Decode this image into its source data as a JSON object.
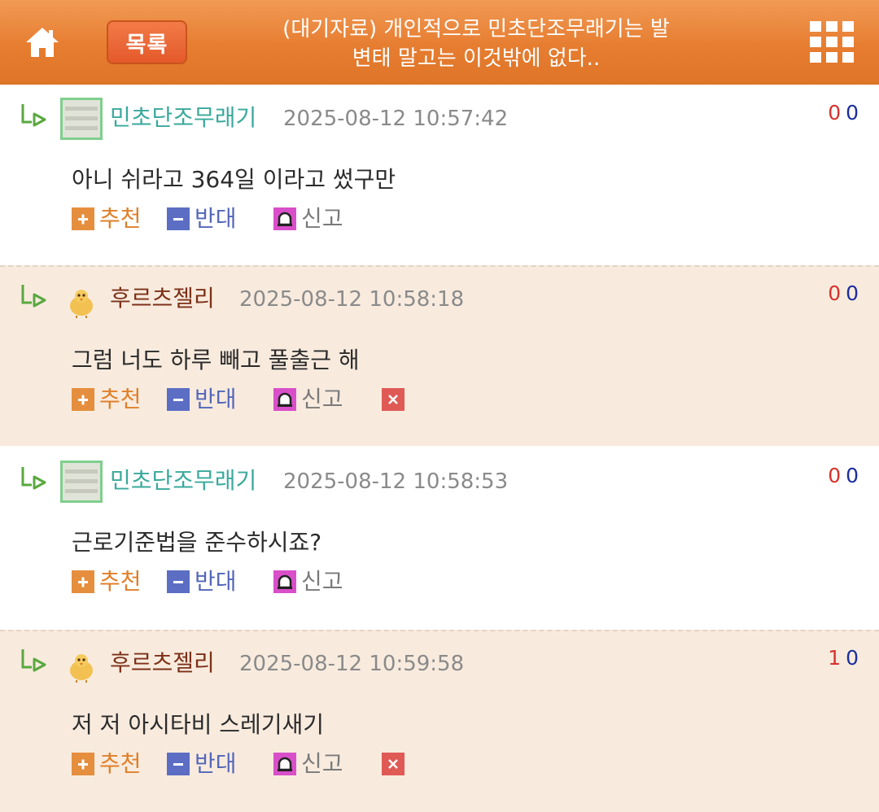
{
  "header": {
    "list_label": "목록",
    "title_line1": "(대기자료) 개인적으로 민초단조무래기는 발",
    "title_line2": "변태 말고는 이것밖에 없다..",
    "icons": {
      "home": "home-icon",
      "menu": "grid-menu-icon"
    },
    "colors": {
      "bar": "#e67d30",
      "list_button": "#e4592a"
    }
  },
  "actions": {
    "recommend": "추천",
    "oppose": "반대",
    "report": "신고"
  },
  "comments": [
    {
      "nickname": "민초단조무래기",
      "datetime": "2025-08-12 10:57:42",
      "text": "아니 쉬라고 364일 이라고 썼구만",
      "up": "0",
      "down": "0"
    },
    {
      "nickname": "후르츠젤리",
      "datetime": "2025-08-12 10:58:18",
      "text": "그럼 너도 하루 빼고 풀출근 해",
      "up": "0",
      "down": "0"
    },
    {
      "nickname": "민초단조무래기",
      "datetime": "2025-08-12 10:58:53",
      "text": "근로기준법을 준수하시죠?",
      "up": "0",
      "down": "0"
    },
    {
      "nickname": "후르츠젤리",
      "datetime": "2025-08-12 10:59:58",
      "text": "저 저 아시타비 스레기새기",
      "up": "1",
      "down": "0"
    }
  ],
  "colors": {
    "alt_row_bg": "#f8ebde",
    "nick_teal": "#3aa99c",
    "nick_brown": "#7d3018",
    "up_count": "#d6332e",
    "down_count": "#1b2f9c"
  }
}
